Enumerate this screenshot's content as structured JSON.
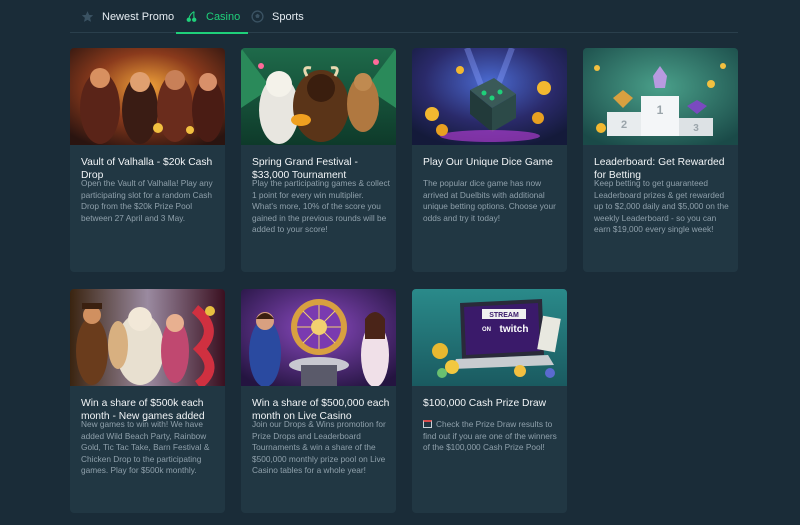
{
  "tabs": [
    {
      "label": "Newest Promo",
      "icon": "star-icon"
    },
    {
      "label": "Casino",
      "icon": "cherries-icon",
      "active": true
    },
    {
      "label": "Sports",
      "icon": "soccer-ball-icon"
    }
  ],
  "cards": [
    {
      "title": "Vault of Valhalla - $20k Cash Drop",
      "description": "Open the Vault of Valhalla! Play any participating slot for a random Cash Drop from the $20k Prize Pool between 27 April and 3 May."
    },
    {
      "title": "Spring Grand Festival - $33,000 Tournament",
      "description": "Play the participating games & collect 1 point for every win multiplier. What's more, 10% of the score you gained in the previous rounds will be added to your score!"
    },
    {
      "title": "Play Our Unique Dice Game",
      "description": "The popular dice game has now arrived at Duelbits with additional unique betting options. Choose your odds and try it today!"
    },
    {
      "title": "Leaderboard: Get Rewarded for Betting",
      "description": "Keep betting to get guaranteed Leaderboard prizes & get rewarded up to $2,000 daily and $5,000 on the weekly Leaderboard - so you can earn $19,000 every single week!"
    },
    {
      "title": "Win a share of $500k each month - New games added",
      "description": "New games to win with! We have added Wild Beach Party, Rainbow Gold, Tic Tac Take, Barn Festival & Chicken Drop to the participating games. Play for $500k monthly."
    },
    {
      "title": "Win a share of $500,000 each month on Live Casino",
      "description": "Join our Drops & Wins promotion for Prize Drops and Leaderboard Tournaments & win a share of the $500,000 monthly prize pool on Live Casino tables for a whole year!"
    },
    {
      "title": "$100,000 Cash Prize Draw",
      "description": "Check the Prize Draw results to find out if you are one of the winners of the $100,000 Cash Prize Pool!"
    }
  ],
  "image_text": {
    "stream": "STREAM",
    "on": "ON",
    "twitch": "twitch",
    "podium_1": "1",
    "podium_2": "2",
    "podium_3": "3"
  },
  "colors": {
    "background": "#1a2c38",
    "card": "#213743",
    "accent": "#1fd07a"
  }
}
